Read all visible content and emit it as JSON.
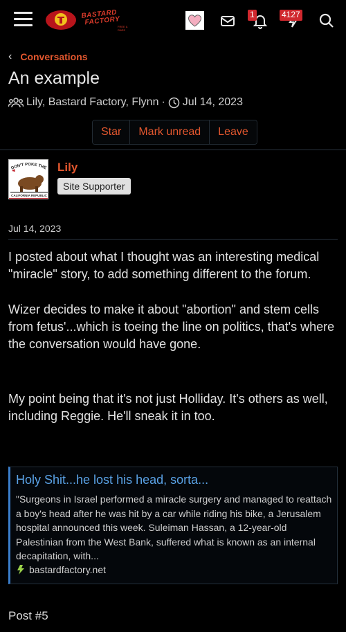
{
  "header": {
    "logo_line1": "BASTARD",
    "logo_line2": "FACTORY",
    "logo_sub": "FREE & RARE",
    "alerts_badge": "1",
    "inbox_badge": "4127",
    "icons": [
      "menu-icon",
      "site-logo",
      "heart-icon",
      "envelope-icon",
      "bell-icon",
      "lightning-icon",
      "search-icon"
    ]
  },
  "breadcrumb": {
    "label": "Conversations"
  },
  "conversation": {
    "title": "An example",
    "participants": "Lily, Bastard Factory, Flynn",
    "separator": "·",
    "date": "Jul 14, 2023"
  },
  "actions": {
    "star": "Star",
    "mark_unread": "Mark unread",
    "leave": "Leave"
  },
  "post": {
    "username": "Lily",
    "user_title": "Site Supporter",
    "avatar_top_text": "DON'T POKE THE BEAR",
    "avatar_bottom_text": "CALIFORNIA REPUBLIC",
    "date": "Jul 14, 2023",
    "paragraphs": [
      "I posted about what I thought was an interesting medical \"miracle\" story, to add something different to the forum.",
      "Wizer decides to make it about \"abortion\" and stem cells from fetus'...which is toeing the line on politics, that's where the conversation would have gone.",
      "My point being that it's not just Holliday. It's others as well, including Reggie. He'll sneak it in too."
    ],
    "unfurl": {
      "title": "Holy Shit...he lost his head, sorta...",
      "description": "\"Surgeons in Israel performed a miracle surgery and managed to reattach a boy's head after he was hit by a car while riding his bike, a Jerusalem hospital announced this week. Suleiman Hassan, a 12-year-old Palestinian from the West Bank, suffered what is known as an internal decapitation, with...",
      "domain": "bastardfactory.net"
    },
    "post_number": "Post #5"
  },
  "colors": {
    "accent": "#e3572e",
    "link": "#5aa2e6",
    "badge": "#d0282e",
    "background": "#000000"
  }
}
